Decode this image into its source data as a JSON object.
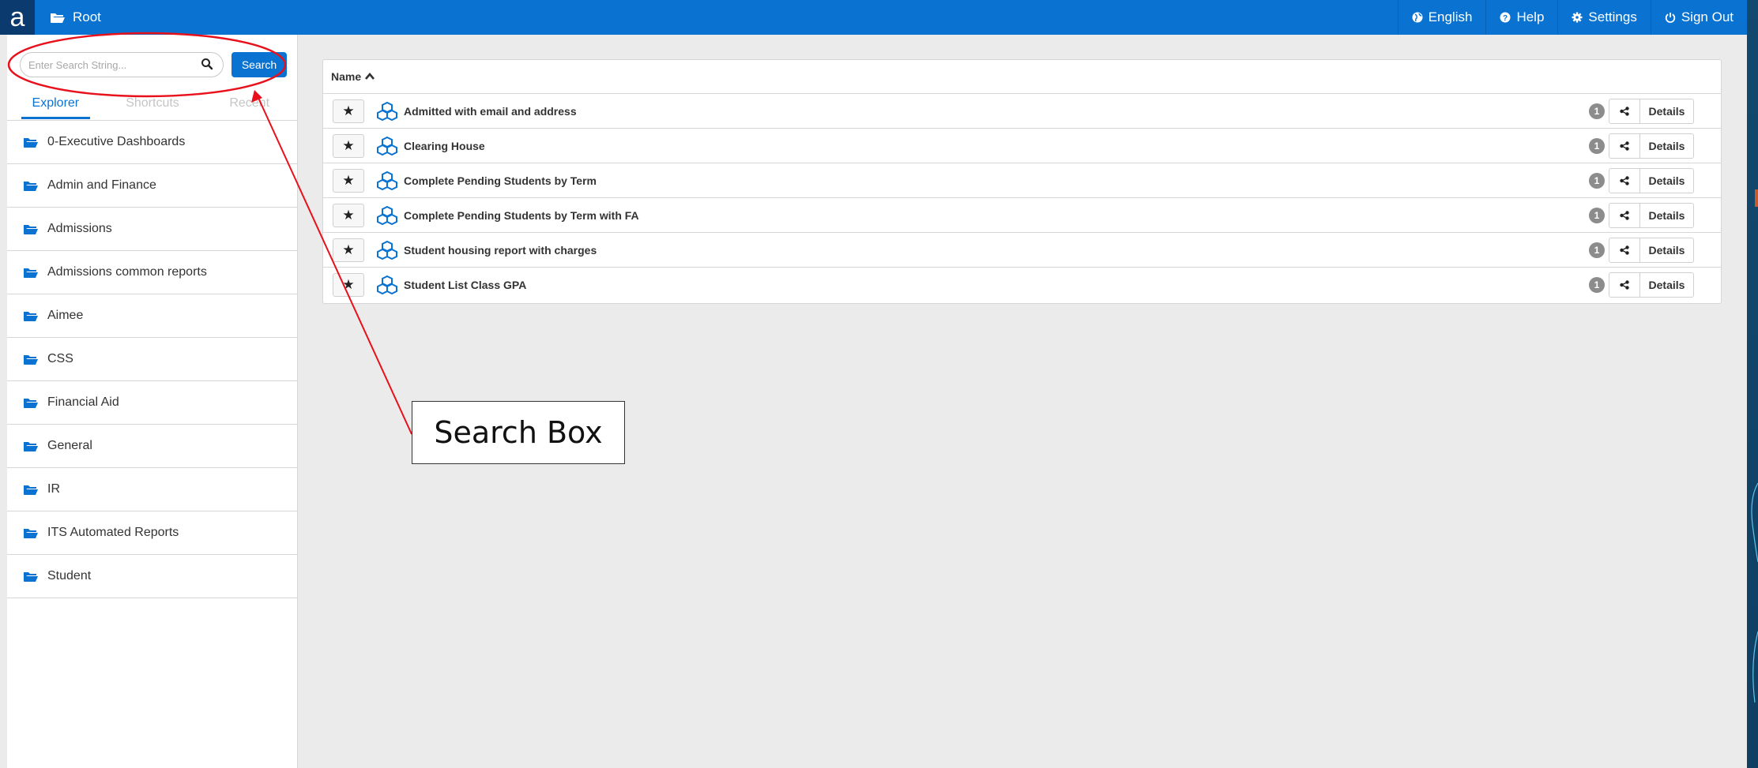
{
  "topbar": {
    "logo_letter": "a",
    "breadcrumb": "Root",
    "nav": [
      {
        "label": "English",
        "icon": "globe-icon"
      },
      {
        "label": "Help",
        "icon": "question-icon"
      },
      {
        "label": "Settings",
        "icon": "gear-icon"
      },
      {
        "label": "Sign Out",
        "icon": "power-icon"
      }
    ]
  },
  "sidebar": {
    "search": {
      "placeholder": "Enter Search String...",
      "value": "",
      "button_label": "Search"
    },
    "tabs": [
      {
        "label": "Explorer",
        "active": true
      },
      {
        "label": "Shortcuts",
        "active": false
      },
      {
        "label": "Recent",
        "active": false
      }
    ],
    "folders": [
      "0-Executive Dashboards",
      "Admin and Finance",
      "Admissions",
      "Admissions common reports",
      "Aimee",
      "CSS",
      "Financial Aid",
      "General",
      "IR",
      "ITS Automated Reports",
      "Student"
    ]
  },
  "main": {
    "column_header": "Name",
    "reports": [
      {
        "name": "Admitted with email and address",
        "badge": "1",
        "details_label": "Details"
      },
      {
        "name": "Clearing House",
        "badge": "1",
        "details_label": "Details"
      },
      {
        "name": "Complete Pending Students by Term",
        "badge": "1",
        "details_label": "Details"
      },
      {
        "name": "Complete Pending Students by Term with FA",
        "badge": "1",
        "details_label": "Details"
      },
      {
        "name": "Student housing report with charges",
        "badge": "1",
        "details_label": "Details"
      },
      {
        "name": "Student List Class GPA",
        "badge": "1",
        "details_label": "Details"
      }
    ]
  },
  "annotation": {
    "label": "Search Box",
    "color": "#e8101a"
  },
  "colors": {
    "accent": "#0a73d1",
    "logo_bg": "#0b3a6e",
    "background": "#ebebeb"
  }
}
